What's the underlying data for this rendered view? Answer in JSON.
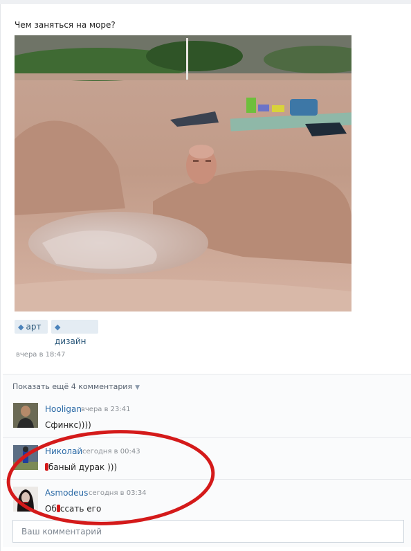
{
  "post": {
    "title": "Чем заняться на море?",
    "tags": [
      {
        "label": "арт",
        "icon": "tag-icon"
      },
      {
        "label": "дизайн",
        "icon": "tag-icon"
      }
    ],
    "date": "вчера в 18:47"
  },
  "comments_section": {
    "show_more": "Показать ещё 4 комментария",
    "comments": [
      {
        "author": "Hooligan",
        "time": "вчера в 23:41",
        "text": "Сфинкс))))"
      },
      {
        "author": "Николай",
        "time": "сегодня в 00:43",
        "text": "баный дурак )))"
      },
      {
        "author": "Asmodeus",
        "time": "сегодня в 03:34",
        "text_before": "Об",
        "text_after": "ссать его"
      }
    ],
    "input_placeholder": "Ваш комментарий"
  },
  "colors": {
    "link": "#2b6aa6",
    "tag_bg": "#e4ecf3",
    "annotation_red": "#d41a1a"
  }
}
